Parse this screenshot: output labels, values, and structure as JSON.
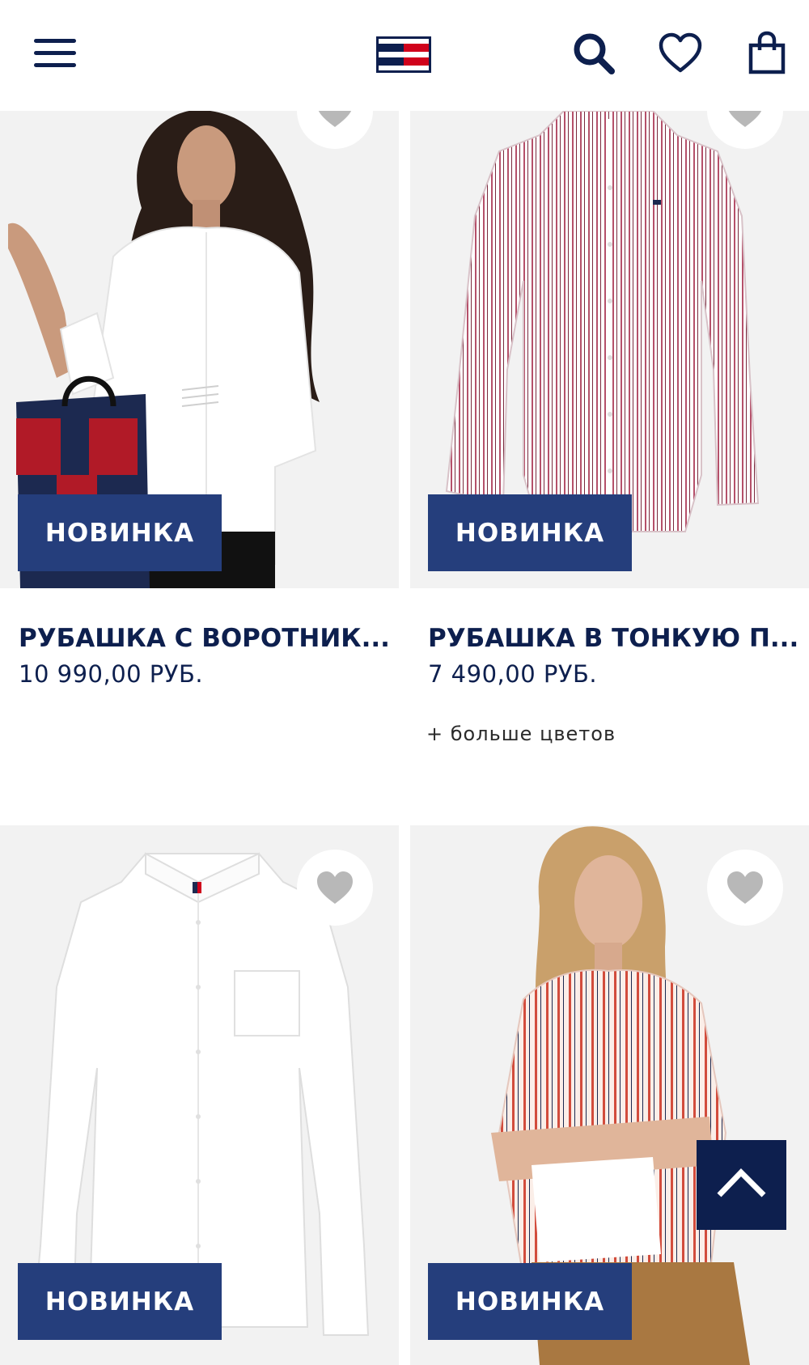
{
  "header": {
    "menu": "menu-icon",
    "logo": "tommy-flag-logo",
    "search": "search-icon",
    "wishlist": "heart-icon",
    "bag": "shopping-bag-icon",
    "colors": {
      "navy": "#0d1f4e",
      "red": "#d0021b",
      "white": "#ffffff"
    }
  },
  "products": [
    {
      "badge": "НОВИНКА",
      "title": "РУБАШКА С ВОРОТНИК...",
      "price": "10 990,00 РУБ."
    },
    {
      "badge": "НОВИНКА",
      "title": "РУБАШКА В ТОНКУЮ П...",
      "price": "7 490,00 РУБ.",
      "more_colors": "+ больше цветов"
    },
    {
      "badge": "НОВИНКА"
    },
    {
      "badge": "НОВИНКА"
    }
  ],
  "scroll_top": "chevron-up-icon",
  "badge_color": "#253e7c"
}
